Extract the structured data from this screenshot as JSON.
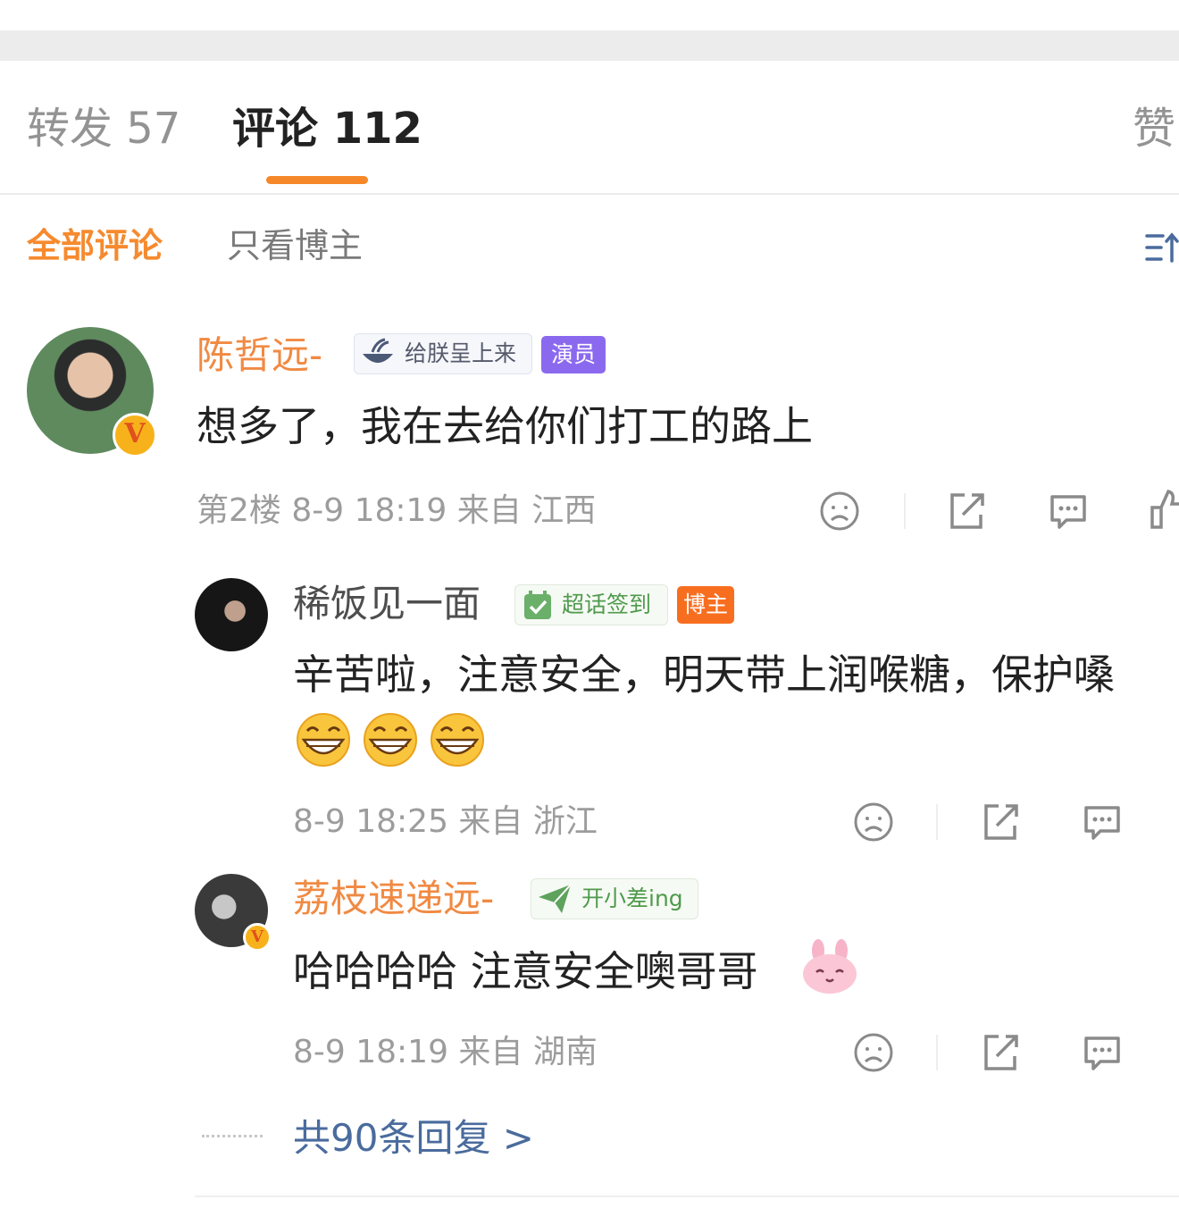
{
  "tabs": {
    "forward": "转发 57",
    "comments": "评论 112",
    "likes": "赞",
    "accent_color": "#f6882a"
  },
  "filters": {
    "all": "全部评论",
    "blogger_only": "只看博主",
    "sort_icon": "sort-icon"
  },
  "comment": {
    "username": "陈哲远-",
    "badge_fan": "给朕呈上来",
    "badge_role": "演员",
    "text": "想多了，我在去给你们打工的路上",
    "meta": "第2楼 8-9 18:19 来自 江西",
    "verified_icon": "verified-v-icon"
  },
  "replies": [
    {
      "username": "稀饭见一面",
      "badge_fan": "超话签到",
      "badge_role": "博主",
      "text": "辛苦啦，注意安全，明天带上润喉糖，保护嗓",
      "emojis": [
        "grin",
        "grin",
        "grin"
      ],
      "meta": "8-9 18:25 来自 浙江"
    },
    {
      "username": "荔枝速递远-",
      "badge_fan": "开小差ing",
      "text": "哈哈哈哈 注意安全噢哥哥",
      "emojis": [
        "pink-rabbit"
      ],
      "meta": "8-9 18:19 来自 湖南"
    }
  ],
  "more_replies": "共90条回复 >",
  "actions": [
    "dislike-icon",
    "share-icon",
    "reply-icon",
    "like-icon"
  ]
}
